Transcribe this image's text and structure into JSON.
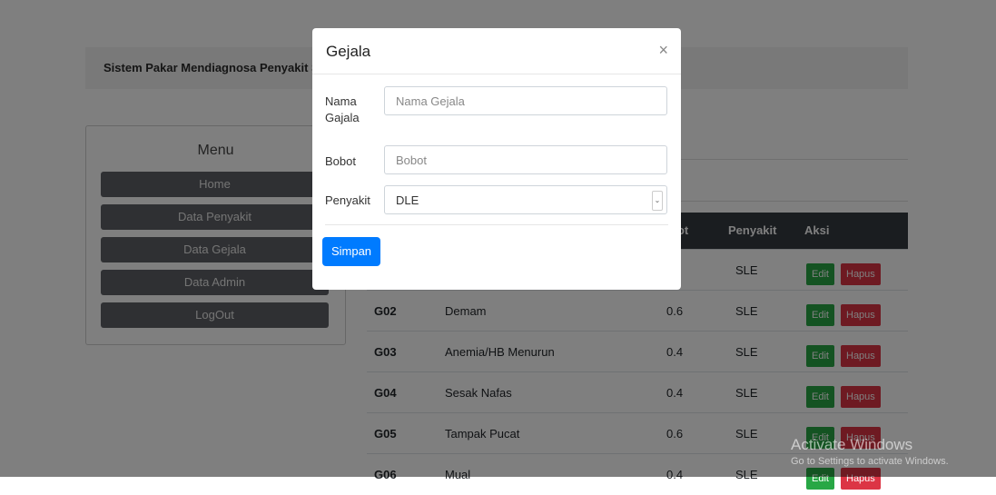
{
  "navbar": {
    "brand": "Sistem Pakar Mendiagnosa Penyakit S"
  },
  "menu": {
    "title": "Menu",
    "items": [
      {
        "label": "Home"
      },
      {
        "label": "Data Penyakit"
      },
      {
        "label": "Data Gejala"
      },
      {
        "label": "Data Admin"
      },
      {
        "label": "LogOut"
      }
    ]
  },
  "table": {
    "headers": {
      "bobot": "bot",
      "penyakit": "Penyakit",
      "aksi": "Aksi"
    },
    "edit_label": "Edit",
    "hapus_label": "Hapus",
    "rows": [
      {
        "kode": "",
        "nama": "",
        "bobot": "",
        "penyakit": "SLE"
      },
      {
        "kode": "G02",
        "nama": "Demam",
        "bobot": "0.6",
        "penyakit": "SLE"
      },
      {
        "kode": "G03",
        "nama": "Anemia/HB Menurun",
        "bobot": "0.4",
        "penyakit": "SLE"
      },
      {
        "kode": "G04",
        "nama": "Sesak Nafas",
        "bobot": "0.4",
        "penyakit": "SLE"
      },
      {
        "kode": "G05",
        "nama": "Tampak Pucat",
        "bobot": "0.6",
        "penyakit": "SLE"
      },
      {
        "kode": "G06",
        "nama": "Mual",
        "bobot": "0.4",
        "penyakit": "SLE"
      }
    ]
  },
  "modal": {
    "title": "Gejala",
    "close_icon": "×",
    "fields": {
      "nama": {
        "label_line1": "Nama",
        "label_line2": "Gajala",
        "placeholder": "Nama Gejala",
        "value": ""
      },
      "bobot": {
        "label": "Bobot",
        "placeholder": "Bobot",
        "value": ""
      },
      "penyakit": {
        "label": "Penyakit",
        "value": "DLE",
        "caret": "⌄"
      }
    },
    "submit_label": "Simpan"
  },
  "watermark": {
    "line1": "Activate Windows",
    "line2": "Go to Settings to activate Windows."
  },
  "colors": {
    "primary": "#007bff",
    "success": "#28a745",
    "danger": "#dc3545",
    "table_head": "#343a40",
    "menu_button": "#5f6166"
  }
}
